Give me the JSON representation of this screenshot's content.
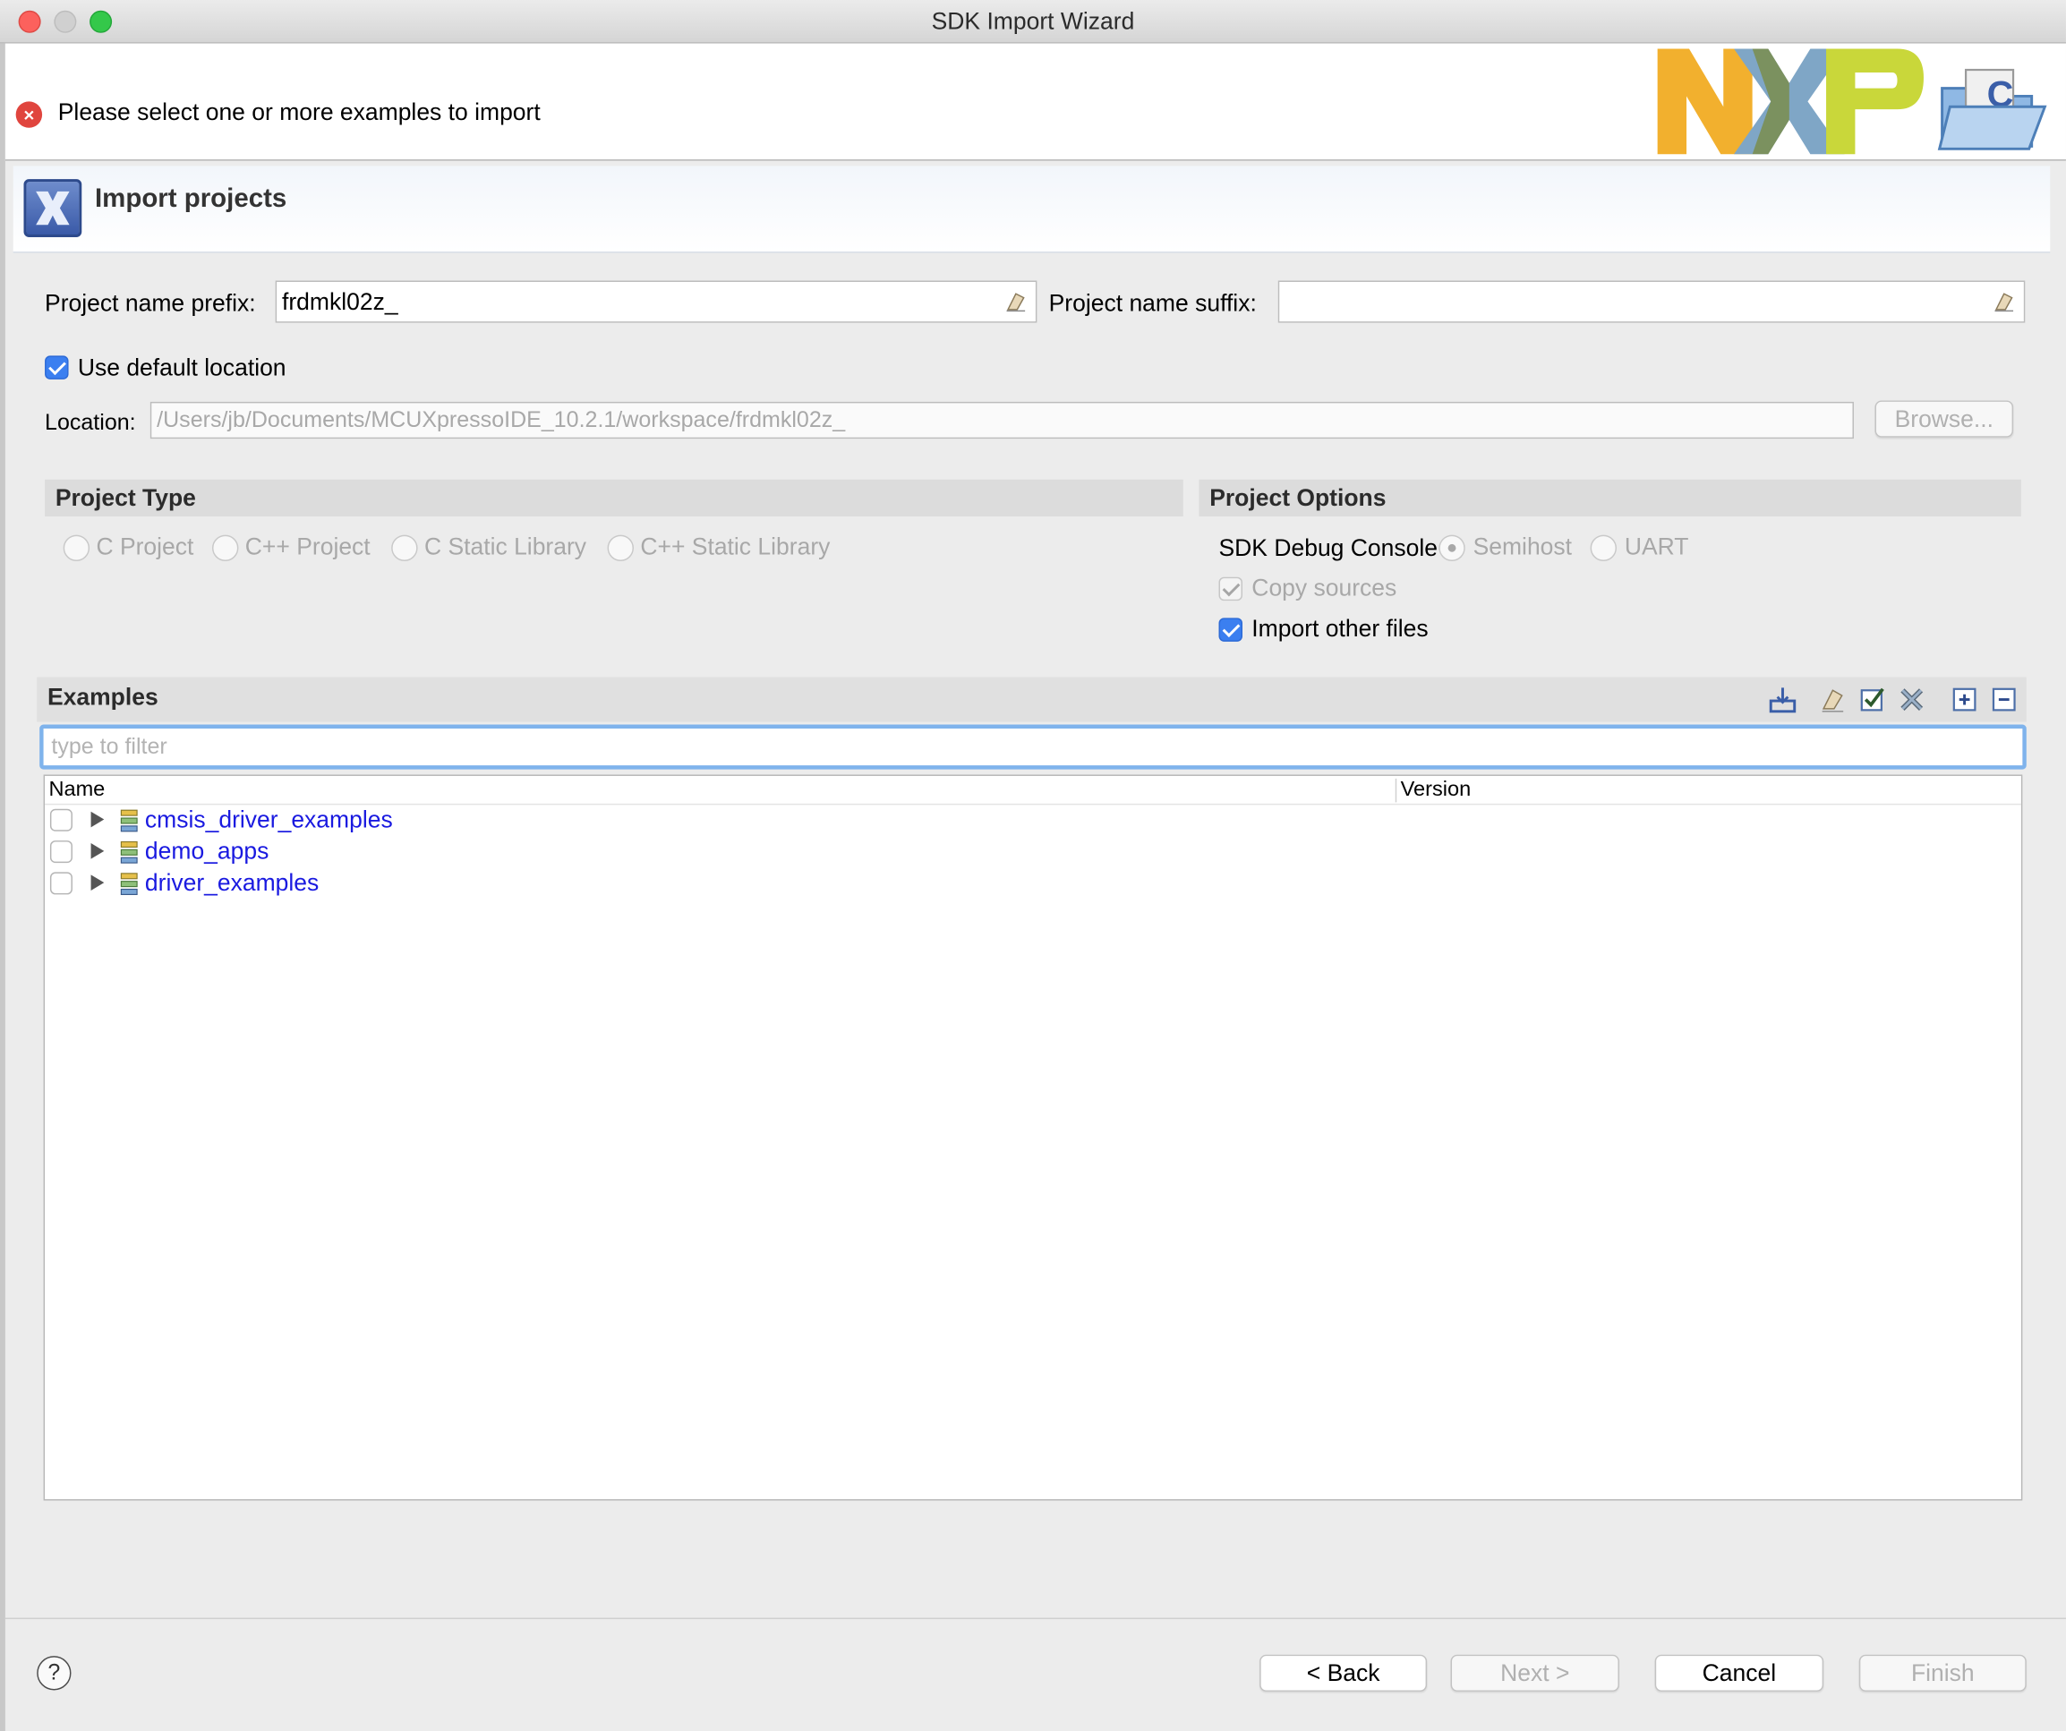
{
  "window": {
    "title": "SDK Import Wizard"
  },
  "banner": {
    "message": "Please select one or more examples to import",
    "logo_text": "NXP"
  },
  "page": {
    "title": "Import projects"
  },
  "form": {
    "prefix_label": "Project name prefix:",
    "prefix_value": "frdmkl02z_",
    "suffix_label": "Project name suffix:",
    "suffix_value": "",
    "use_default_location_label": "Use default location",
    "use_default_location_checked": true,
    "location_label": "Location:",
    "location_value": "/Users/jb/Documents/MCUXpressoIDE_10.2.1/workspace/frdmkl02z_",
    "browse_label": "Browse..."
  },
  "project_type": {
    "title": "Project Type",
    "options": [
      "C Project",
      "C++ Project",
      "C Static Library",
      "C++ Static Library"
    ]
  },
  "project_options": {
    "title": "Project Options",
    "debug_console_label": "SDK Debug Console",
    "debug_options": [
      "Semihost",
      "UART"
    ],
    "debug_selected": "Semihost",
    "copy_sources_label": "Copy sources",
    "copy_sources_checked": true,
    "import_other_label": "Import other files",
    "import_other_checked": true
  },
  "examples": {
    "title": "Examples",
    "filter_placeholder": "type to filter",
    "columns": [
      "Name",
      "Version"
    ],
    "rows": [
      {
        "name": "cmsis_driver_examples",
        "version": ""
      },
      {
        "name": "demo_apps",
        "version": ""
      },
      {
        "name": "driver_examples",
        "version": ""
      }
    ]
  },
  "footer": {
    "help_label": "?",
    "back_label": "< Back",
    "next_label": "Next >",
    "cancel_label": "Cancel",
    "finish_label": "Finish"
  },
  "colors": {
    "accent": "#3b7ff0",
    "link": "#1a1ae0",
    "error": "#e0453e"
  }
}
